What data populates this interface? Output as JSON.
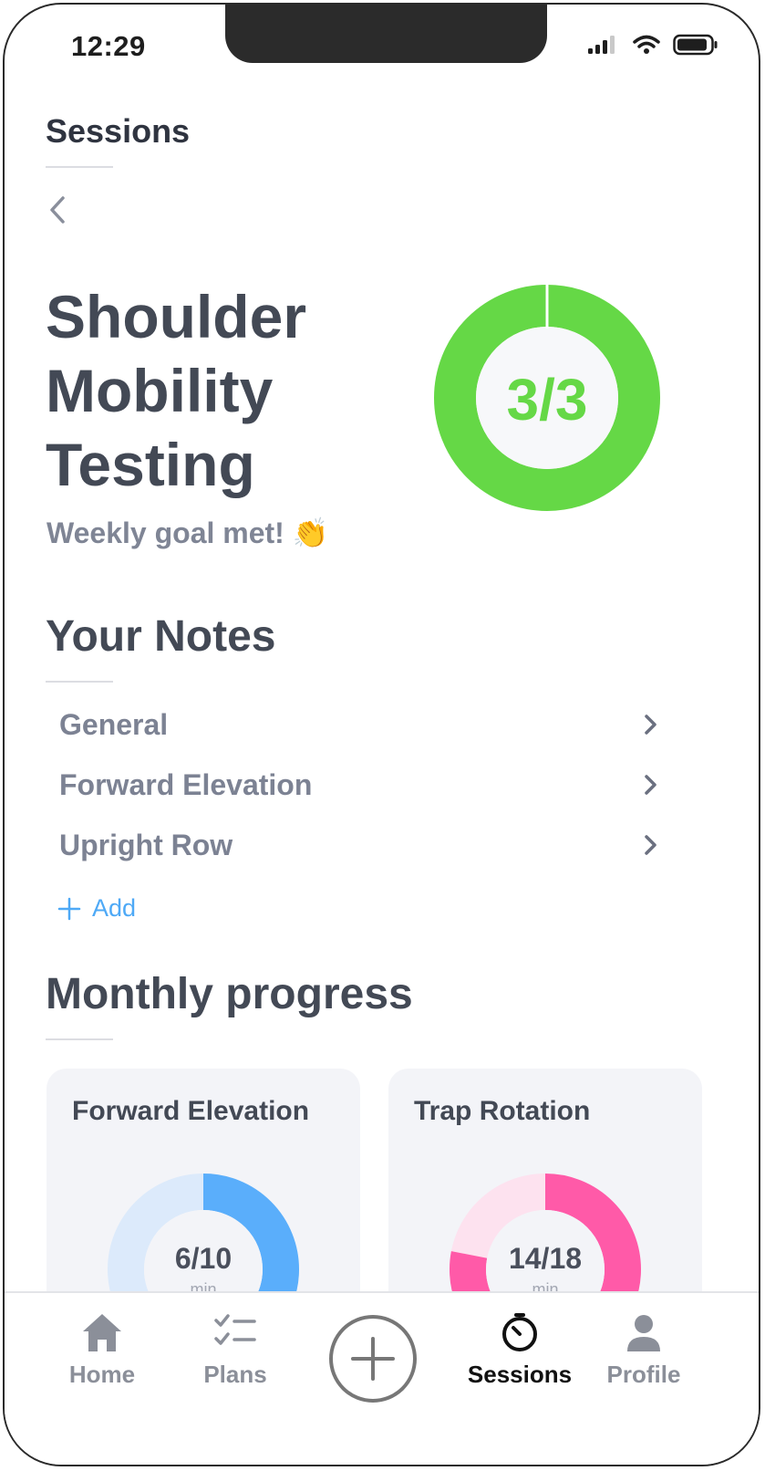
{
  "status_bar": {
    "time": "12:29"
  },
  "header": {
    "title": "Sessions"
  },
  "session": {
    "title_lines": [
      "Shoulder",
      "Mobility",
      "Testing"
    ],
    "subtitle": "Weekly goal met! 👏",
    "progress_label": "3/3",
    "progress_fraction": 1.0,
    "accent": "#65d846"
  },
  "notes": {
    "title": "Your Notes",
    "items": [
      {
        "label": "General"
      },
      {
        "label": "Forward Elevation"
      },
      {
        "label": "Upright Row"
      }
    ],
    "add_label": "Add"
  },
  "monthly": {
    "title": "Monthly progress",
    "cards": [
      {
        "title": "Forward Elevation",
        "value": "6/10",
        "unit": "min",
        "fraction": 0.6,
        "color": "#5aaefb",
        "track": "#dceafb"
      },
      {
        "title": "Trap Rotation",
        "value": "14/18",
        "unit": "min",
        "fraction": 0.78,
        "color": "#ff5aa8",
        "track": "#fde2ef"
      }
    ]
  },
  "tabbar": {
    "tabs": [
      {
        "label": "Home",
        "icon": "home-icon"
      },
      {
        "label": "Plans",
        "icon": "checklist-icon"
      },
      {
        "label": "Sessions",
        "icon": "timer-icon",
        "active": true
      },
      {
        "label": "Profile",
        "icon": "person-icon"
      }
    ],
    "center_icon": "plus-icon"
  }
}
